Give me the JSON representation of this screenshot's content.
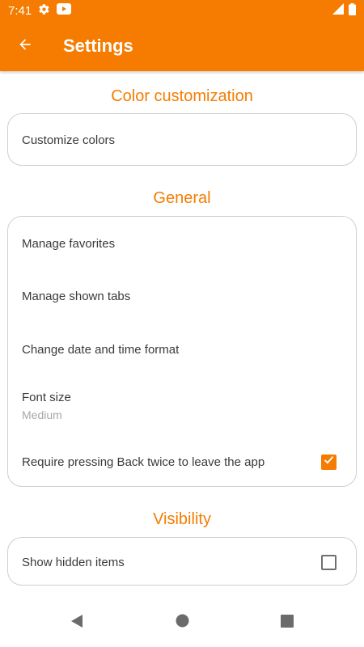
{
  "status_bar": {
    "time": "7:41"
  },
  "app_bar": {
    "title": "Settings"
  },
  "sections": {
    "color": {
      "title": "Color customization",
      "items": [
        {
          "label": "Customize colors"
        }
      ]
    },
    "general": {
      "title": "General",
      "items": [
        {
          "label": "Manage favorites"
        },
        {
          "label": "Manage shown tabs"
        },
        {
          "label": "Change date and time format"
        },
        {
          "label": "Font size",
          "value": "Medium"
        },
        {
          "label": "Require pressing Back twice to leave the app",
          "checked": true
        }
      ]
    },
    "visibility": {
      "title": "Visibility",
      "items": [
        {
          "label": "Show hidden items",
          "checked": false
        }
      ]
    }
  },
  "colors": {
    "accent": "#f57c00",
    "text": "#3a3a3a",
    "secondary_text": "#a8a8a8"
  }
}
